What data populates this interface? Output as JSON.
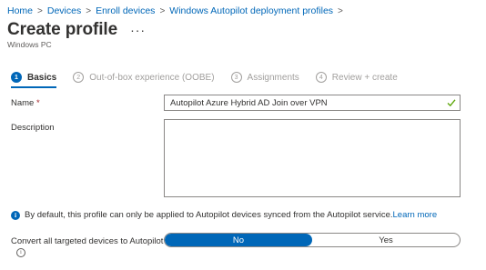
{
  "breadcrumb": [
    "Home",
    "Devices",
    "Enroll devices",
    "Windows Autopilot deployment profiles"
  ],
  "page": {
    "title": "Create profile",
    "more": "···",
    "subtitle": "Windows PC"
  },
  "steps": [
    {
      "num": "1",
      "label": "Basics"
    },
    {
      "num": "2",
      "label": "Out-of-box experience (OOBE)"
    },
    {
      "num": "3",
      "label": "Assignments"
    },
    {
      "num": "4",
      "label": "Review + create"
    }
  ],
  "form": {
    "name_label": "Name",
    "required_mark": "*",
    "name_value": "Autopilot Azure Hybrid AD Join over VPN",
    "description_label": "Description",
    "description_value": ""
  },
  "info": {
    "text": "By default, this profile can only be applied to Autopilot devices synced from the Autopilot service.",
    "link": "Learn more",
    "icon_glyph": "i"
  },
  "convert": {
    "label": "Convert all targeted devices to Autopilot",
    "info_glyph": "i",
    "options": [
      "No",
      "Yes"
    ],
    "selected": "No"
  },
  "colors": {
    "accent": "#0067b8",
    "valid": "#57a300"
  }
}
